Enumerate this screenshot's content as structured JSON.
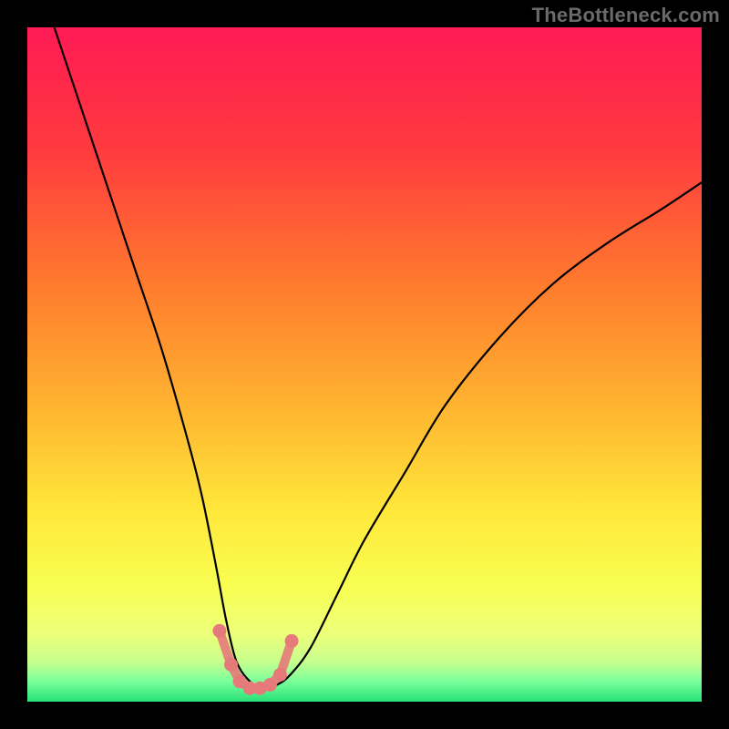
{
  "watermark": "TheBottleneck.com",
  "chart_data": {
    "type": "line",
    "title": "",
    "xlabel": "",
    "ylabel": "",
    "xlim": [
      0,
      100
    ],
    "ylim": [
      0,
      100
    ],
    "grid": false,
    "series": [
      {
        "name": "bottleneck-curve",
        "color": "#000000",
        "x": [
          4,
          8,
          12,
          16,
          20,
          24,
          26,
          28,
          29.5,
          31,
          33,
          35,
          37,
          39,
          42,
          46,
          50,
          56,
          62,
          70,
          78,
          86,
          94,
          100
        ],
        "values": [
          100,
          88,
          76,
          64,
          52,
          38,
          30,
          20,
          12,
          6,
          3,
          2,
          2.5,
          4,
          8,
          16,
          24,
          34,
          44,
          54,
          62,
          68,
          73,
          77
        ]
      },
      {
        "name": "minimum-band-markers",
        "color": "#e67a7a",
        "x": [
          28.5,
          30.2,
          31.5,
          33,
          34.5,
          36,
          37.5,
          39.2
        ],
        "values": [
          10.5,
          5.5,
          3,
          2,
          2,
          2.5,
          4,
          9
        ]
      }
    ],
    "gradient_stops": [
      {
        "offset": 0.0,
        "color": "#ff1a55"
      },
      {
        "offset": 0.18,
        "color": "#ff3a3f"
      },
      {
        "offset": 0.38,
        "color": "#ff7a2e"
      },
      {
        "offset": 0.55,
        "color": "#ffb030"
      },
      {
        "offset": 0.72,
        "color": "#ffe83a"
      },
      {
        "offset": 0.83,
        "color": "#f8ff52"
      },
      {
        "offset": 0.9,
        "color": "#ecff7a"
      },
      {
        "offset": 0.94,
        "color": "#c8ff8e"
      },
      {
        "offset": 0.97,
        "color": "#7aff9a"
      },
      {
        "offset": 1.0,
        "color": "#28e27a"
      }
    ]
  }
}
